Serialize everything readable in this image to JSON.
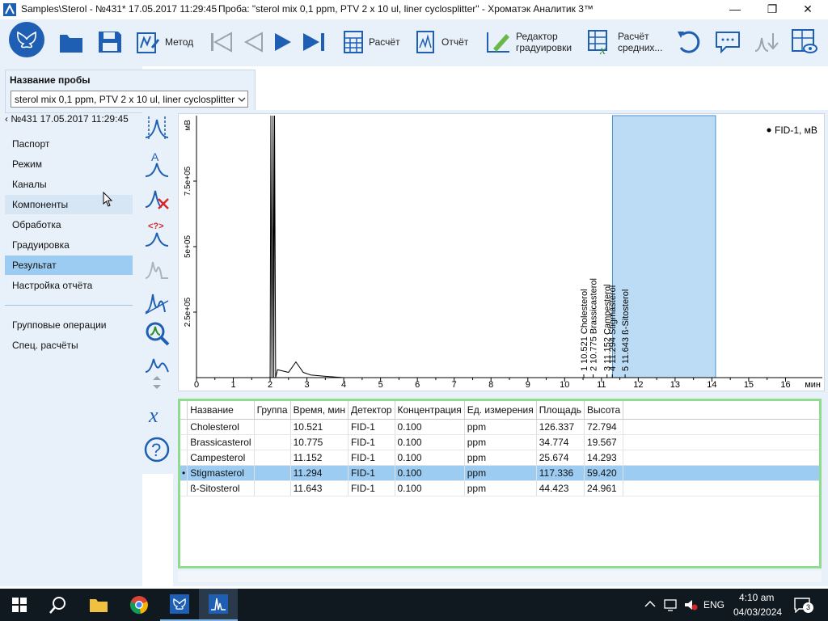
{
  "window": {
    "path": "Samples\\Sterol - №431* 17.05.2017 11:29:45",
    "title": "Проба: \"sterol mix 0,1 ppm, PTV 2 x 10 ul, liner cyclosplitter\" - Хроматэк Аналитик 3™",
    "minimize": "—",
    "maximize": "❐",
    "close": "✕"
  },
  "toolbar": {
    "method": "Метод",
    "calc": "Расчёт",
    "report": "Отчёт",
    "calib_editor_1": "Редактор",
    "calib_editor_2": "градуировки",
    "calc_avg_1": "Расчёт",
    "calc_avg_2": "средних..."
  },
  "sample": {
    "label": "Название пробы",
    "value": "sterol mix 0,1 ppm, PTV 2 x 10 ul, liner cyclosplitter"
  },
  "nav": {
    "back": "№431 17.05.2017 11:29:45",
    "items": [
      "Паспорт",
      "Режим",
      "Каналы",
      "Компоненты",
      "Обработка",
      "Градуировка",
      "Результат",
      "Настройка отчёта"
    ],
    "extra": [
      "Групповые операции",
      "Спец. расчёты"
    ]
  },
  "colors": {
    "accent": "#1e5fb4",
    "selection": "#9cccf1",
    "table_border": "#8fdc8f",
    "band": "#bcdcf5"
  },
  "chart_data": {
    "type": "line",
    "ylabel": "мВ",
    "xlabel": "мин",
    "yticks": [
      "2.5e+05",
      "5e+05",
      "7.5e+05"
    ],
    "xticks": [
      "0",
      "1",
      "2",
      "3",
      "4",
      "5",
      "6",
      "7",
      "8",
      "9",
      "10",
      "11",
      "12",
      "13",
      "14",
      "15",
      "16"
    ],
    "xlim": [
      0,
      17
    ],
    "ylim": [
      0,
      1000000
    ],
    "legend": "FID-1, мВ",
    "legend_position": "top-right",
    "selected_range": [
      11.3,
      14.1
    ],
    "series": [
      {
        "name": "FID-1, мВ",
        "x": [
          0.0,
          2.0,
          2.02,
          2.05,
          2.08,
          2.1,
          2.12,
          2.15,
          2.2,
          2.5,
          2.7,
          2.9,
          3.1,
          3.5,
          4.0,
          5.0,
          17.0
        ],
        "y": [
          0,
          0,
          1000000,
          0,
          1000000,
          0,
          1000000,
          0,
          30000,
          20000,
          60000,
          20000,
          10000,
          5000,
          0,
          0,
          0
        ]
      }
    ],
    "peaks": [
      {
        "label": "1 10.521  Cholesterol",
        "x": 10.521
      },
      {
        "label": "2 10.775  Brassicasterol",
        "x": 10.775
      },
      {
        "label": "3 11.152  Campesterol",
        "x": 11.152
      },
      {
        "label": "4 11.294  Stigmasterol",
        "x": 11.294
      },
      {
        "label": "5 11.643  ß-Sitosterol",
        "x": 11.643
      }
    ]
  },
  "table": {
    "headers": [
      "Название",
      "Группа",
      "Время, мин",
      "Детектор",
      "Концентрация",
      "Ед. измерения",
      "Площадь",
      "Высота"
    ],
    "rows": [
      [
        "Cholesterol",
        "",
        "10.521",
        "FID-1",
        "0.100",
        "ppm",
        "126.337",
        "72.794"
      ],
      [
        "Brassicasterol",
        "",
        "10.775",
        "FID-1",
        "0.100",
        "ppm",
        "34.774",
        "19.567"
      ],
      [
        "Campesterol",
        "",
        "11.152",
        "FID-1",
        "0.100",
        "ppm",
        "25.674",
        "14.293"
      ],
      [
        "Stigmasterol",
        "",
        "11.294",
        "FID-1",
        "0.100",
        "ppm",
        "117.336",
        "59.420"
      ],
      [
        "ß-Sitosterol",
        "",
        "11.643",
        "FID-1",
        "0.100",
        "ppm",
        "44.423",
        "24.961"
      ]
    ],
    "selected_row": 3,
    "selected_marker": "•"
  },
  "taskbar": {
    "lang": "ENG",
    "time": "4:10 am",
    "date": "04/03/2024",
    "notifications": "3"
  }
}
